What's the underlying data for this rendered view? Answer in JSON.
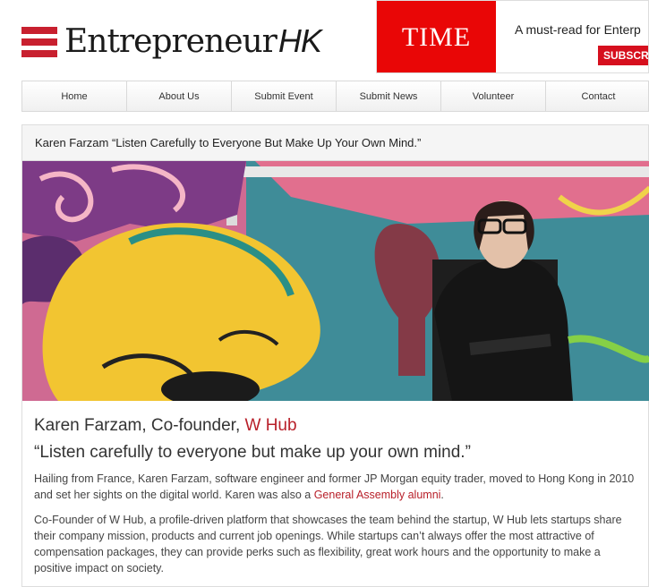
{
  "site": {
    "logo_main": "Entrepreneur",
    "logo_suffix": "HK"
  },
  "ad": {
    "brand": "TIME",
    "tagline": "A must-read for Enterp",
    "cta": "SUBSCRIB"
  },
  "nav": {
    "items": [
      {
        "label": "Home"
      },
      {
        "label": "About Us"
      },
      {
        "label": "Submit Event"
      },
      {
        "label": "Submit News"
      },
      {
        "label": "Volunteer"
      },
      {
        "label": "Contact"
      }
    ]
  },
  "article": {
    "header_title": "Karen Farzam “Listen Carefully to Everyone But Make Up Your Own Mind.”",
    "name_prefix": "Karen Farzam, Co-founder, ",
    "company_link": "W Hub",
    "quote": "“Listen carefully to everyone but make up your own mind.”",
    "para1_text": "Hailing from France, Karen Farzam, software engineer and former JP Morgan equity trader, moved to Hong Kong in 2010 and set her sights on the digital world. Karen was also a ",
    "para1_link": "General Assembly alumni",
    "para1_end": ".",
    "para2": "Co-Founder of W Hub, a profile-driven platform that showcases the team behind the startup, W Hub lets startups share their company mission, products and current job openings. While startups can’t always offer the most attractive of compensation packages, they can provide perks such as flexibility, great work hours and the opportunity to make a positive impact on society."
  },
  "colors": {
    "brand_red": "#c8202f",
    "time_red": "#e90606",
    "link_red": "#b8202a"
  }
}
